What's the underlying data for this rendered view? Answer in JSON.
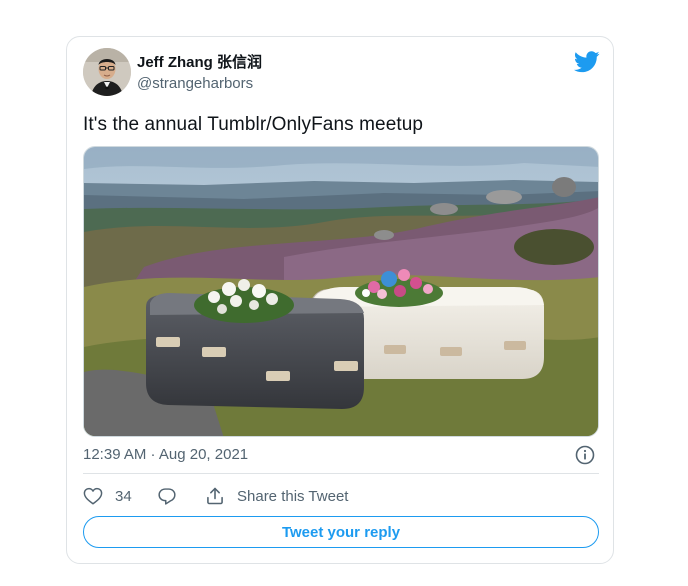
{
  "author": {
    "display_name": "Jeff Zhang 张信润",
    "handle": "@strangeharbors"
  },
  "tweet": {
    "text": "It's the annual Tumblr/OnlyFans meetup",
    "timestamp": "12:39 AM · Aug 20, 2021"
  },
  "actions": {
    "like_count": "34",
    "share_label": "Share this Tweet"
  },
  "reply_button": {
    "label": "Tweet your reply"
  },
  "icons": {
    "brand": "twitter-bird-icon",
    "info": "info-icon",
    "like": "heart-icon",
    "reply": "speech-bubble-icon",
    "share": "share-icon"
  },
  "colors": {
    "accent": "#1d9bf0",
    "text": "#0f1419",
    "secondary": "#536471",
    "border": "#dfe3e6"
  }
}
